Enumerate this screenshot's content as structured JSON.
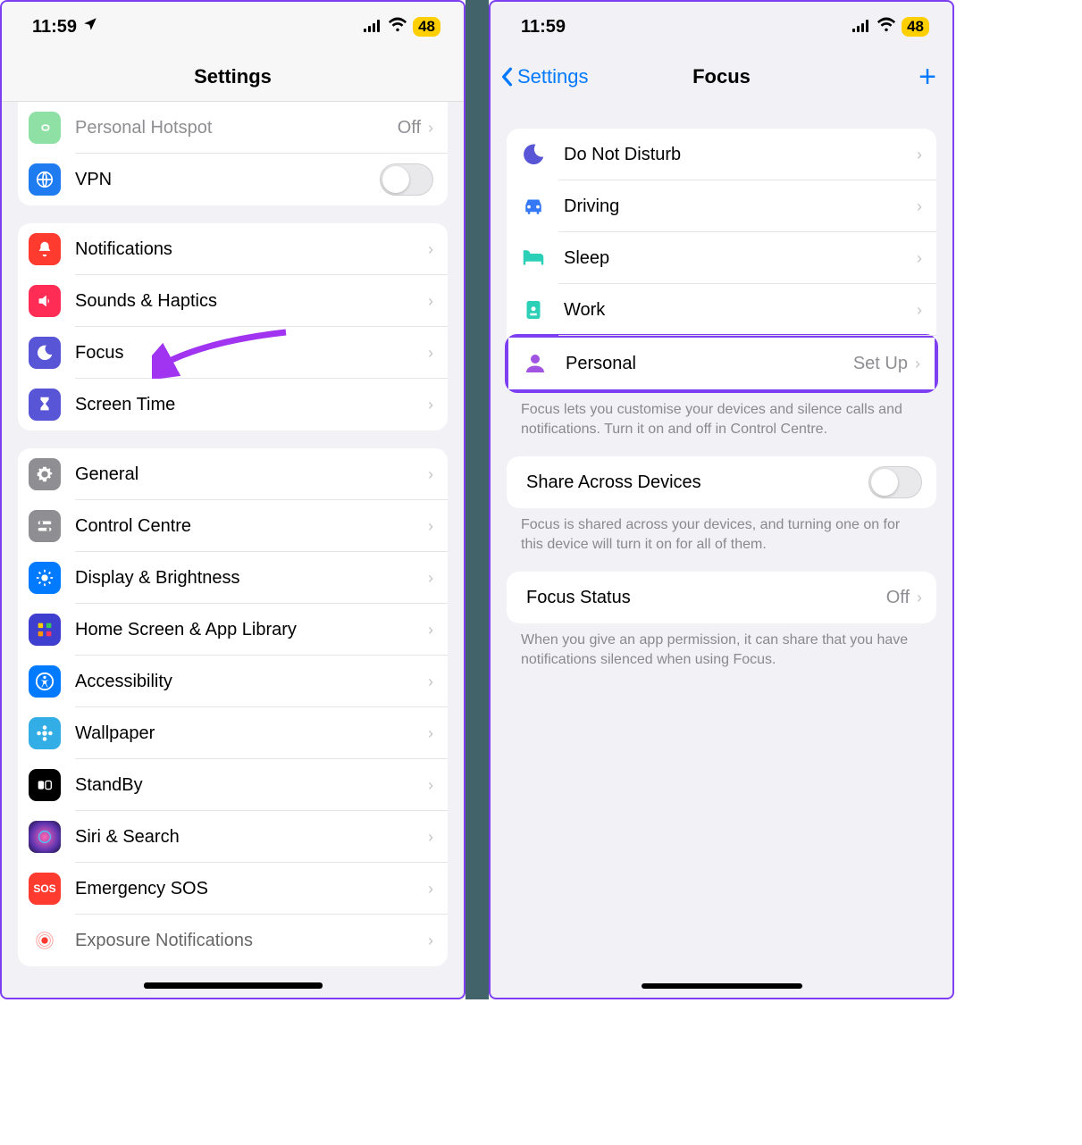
{
  "status": {
    "time": "11:59",
    "battery": "48"
  },
  "left": {
    "title": "Settings",
    "group_net": [
      {
        "label": "Personal Hotspot",
        "detail": "Off",
        "color": "#8fe0a4",
        "icon": "link",
        "disabled": true
      },
      {
        "label": "VPN",
        "detail": "",
        "color": "#1e7bf0",
        "icon": "globe",
        "toggle": true
      }
    ],
    "group_notify": [
      {
        "label": "Notifications",
        "color": "#ff3b30",
        "icon": "bell"
      },
      {
        "label": "Sounds & Haptics",
        "color": "#ff2d55",
        "icon": "speaker"
      },
      {
        "label": "Focus",
        "color": "#5856d6",
        "icon": "moon"
      },
      {
        "label": "Screen Time",
        "color": "#5856d6",
        "icon": "hourglass"
      }
    ],
    "group_general": [
      {
        "label": "General",
        "color": "#8e8e93",
        "icon": "gear"
      },
      {
        "label": "Control Centre",
        "color": "#8e8e93",
        "icon": "switches"
      },
      {
        "label": "Display & Brightness",
        "color": "#007aff",
        "icon": "sun"
      },
      {
        "label": "Home Screen & App Library",
        "color": "#4040ff",
        "icon": "apps"
      },
      {
        "label": "Accessibility",
        "color": "#007aff",
        "icon": "accessibility"
      },
      {
        "label": "Wallpaper",
        "color": "#32ade6",
        "icon": "flower"
      },
      {
        "label": "StandBy",
        "color": "#000000",
        "icon": "standby"
      },
      {
        "label": "Siri & Search",
        "color": "#202030",
        "icon": "siri"
      },
      {
        "label": "Emergency SOS",
        "color": "#ff3b30",
        "icon": "sos"
      },
      {
        "label": "Exposure Notifications",
        "color": "#ffffff",
        "icon": "exposure"
      }
    ]
  },
  "right": {
    "back": "Settings",
    "title": "Focus",
    "modes": [
      {
        "label": "Do Not Disturb",
        "icon": "moon",
        "tint": "#5856d6"
      },
      {
        "label": "Driving",
        "icon": "car",
        "tint": "#3478f6"
      },
      {
        "label": "Sleep",
        "icon": "bed",
        "tint": "#2bd0b7"
      },
      {
        "label": "Work",
        "icon": "badge",
        "tint": "#2bd0b7"
      },
      {
        "label": "Personal",
        "icon": "person",
        "tint": "#a153e2",
        "detail": "Set Up",
        "highlight": true
      }
    ],
    "modes_footer": "Focus lets you customise your devices and silence calls and notifications. Turn it on and off in Control Centre.",
    "share": {
      "label": "Share Across Devices"
    },
    "share_footer": "Focus is shared across your devices, and turning one on for this device will turn it on for all of them.",
    "status": {
      "label": "Focus Status",
      "detail": "Off"
    },
    "status_footer": "When you give an app permission, it can share that you have notifications silenced when using Focus."
  }
}
